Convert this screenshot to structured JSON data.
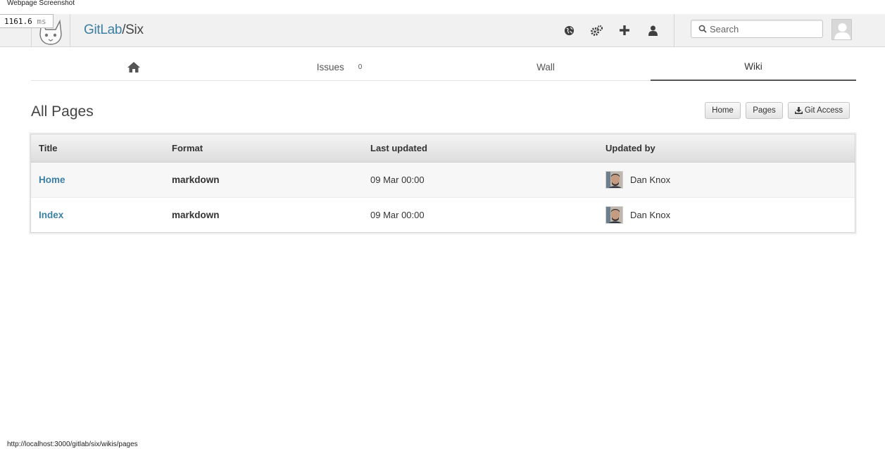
{
  "page_label": "Webpage Screenshot",
  "timing": {
    "value": "1161.6",
    "unit": "ms"
  },
  "header": {
    "group": "GitLab",
    "separator": "/",
    "project": "Six",
    "icons": [
      "globe-icon",
      "cogs-icon",
      "plus-icon",
      "user-icon"
    ],
    "search_placeholder": "Search"
  },
  "tabs": [
    {
      "label": "",
      "icon": "home-icon"
    },
    {
      "label": "Issues",
      "count": "0"
    },
    {
      "label": "Wall"
    },
    {
      "label": "Wiki",
      "active": true
    }
  ],
  "main": {
    "title": "All Pages",
    "buttons": {
      "home": "Home",
      "pages": "Pages",
      "git_access": "Git Access"
    }
  },
  "table": {
    "headers": [
      "Title",
      "Format",
      "Last updated",
      "Updated by"
    ],
    "rows": [
      {
        "title": "Home",
        "format": "markdown",
        "updated": "09 Mar 00:00",
        "user": "Dan Knox"
      },
      {
        "title": "Index",
        "format": "markdown",
        "updated": "09 Mar 00:00",
        "user": "Dan Knox"
      }
    ]
  },
  "status_url": "http://localhost:3000/gitlab/six/wikis/pages",
  "colors": {
    "link": "#3b7fa4",
    "header_bg": "#f1f1f1"
  }
}
